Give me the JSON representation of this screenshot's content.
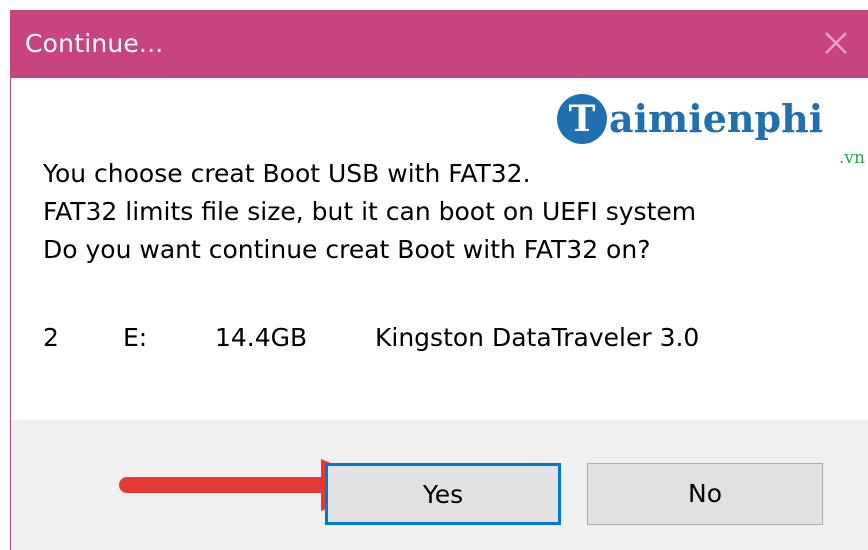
{
  "window": {
    "title": "Continue..."
  },
  "logo": {
    "letter": "T",
    "text": "aimienphi",
    "suffix": ".vn"
  },
  "message": {
    "lines": [
      "You choose creat Boot USB with FAT32.",
      "FAT32 limits file size, but it can boot on UEFI system",
      "Do you want continue creat Boot with FAT32 on?"
    ]
  },
  "device": {
    "index": "2",
    "drive": "E:",
    "size": "14.4GB",
    "name": "Kingston DataTraveler 3.0"
  },
  "buttons": {
    "yes_label": "Yes",
    "no_label": "No"
  },
  "colors": {
    "titlebar": "#c8447f",
    "arrow": "#e53935",
    "logo_blue": "#1f6fb1",
    "logo_green": "#2aa34a",
    "focus_border": "#0078d7"
  },
  "icons": {
    "close": "close-icon",
    "arrow": "red-arrow-icon"
  }
}
